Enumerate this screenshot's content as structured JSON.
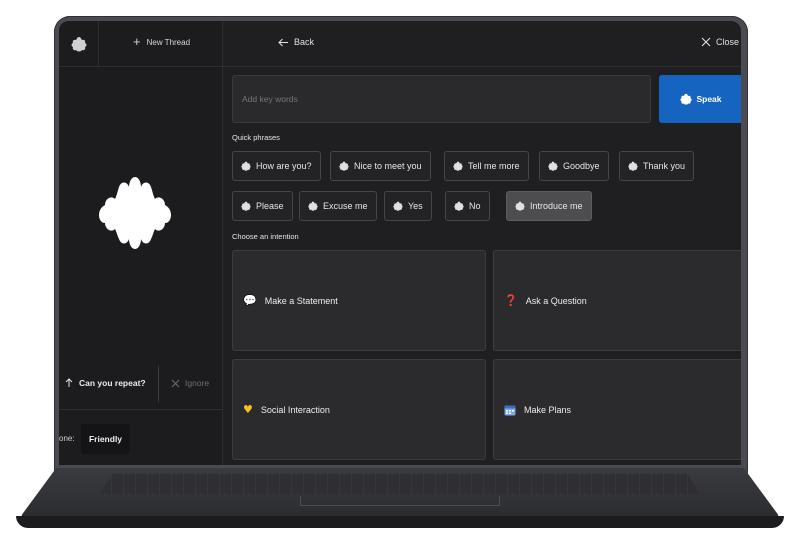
{
  "header": {
    "new_thread_label": "New Thread",
    "back_label": "Back",
    "close_label": "Close"
  },
  "sidebar": {
    "repeat_label": "Can you repeat?",
    "ignore_label": "Ignore",
    "tone_label": "one:",
    "tone_value": "Friendly"
  },
  "input": {
    "placeholder": "Add key words",
    "value": ""
  },
  "speak_label": "Speak",
  "quick_phrases": {
    "label": "Quick phrases",
    "items": [
      "How are you?",
      "Nice to meet you",
      "Tell me more",
      "Goodbye",
      "Thank you",
      "Please",
      "Excuse me",
      "Yes",
      "No",
      "Introduce me"
    ],
    "active": "Introduce me"
  },
  "intentions": {
    "label": "Choose an intention",
    "items": [
      {
        "label": "Make a Statement",
        "icon": "speech-bubble-icon"
      },
      {
        "label": "Ask a Question",
        "icon": "question-mark-icon"
      },
      {
        "label": "Social Interaction",
        "icon": "handshake-icon"
      },
      {
        "label": "Make Plans",
        "icon": "calendar-icon"
      }
    ]
  },
  "colors": {
    "accent": "#1565c0",
    "background": "#1f1f21",
    "chip_active": "#4d4d50"
  }
}
